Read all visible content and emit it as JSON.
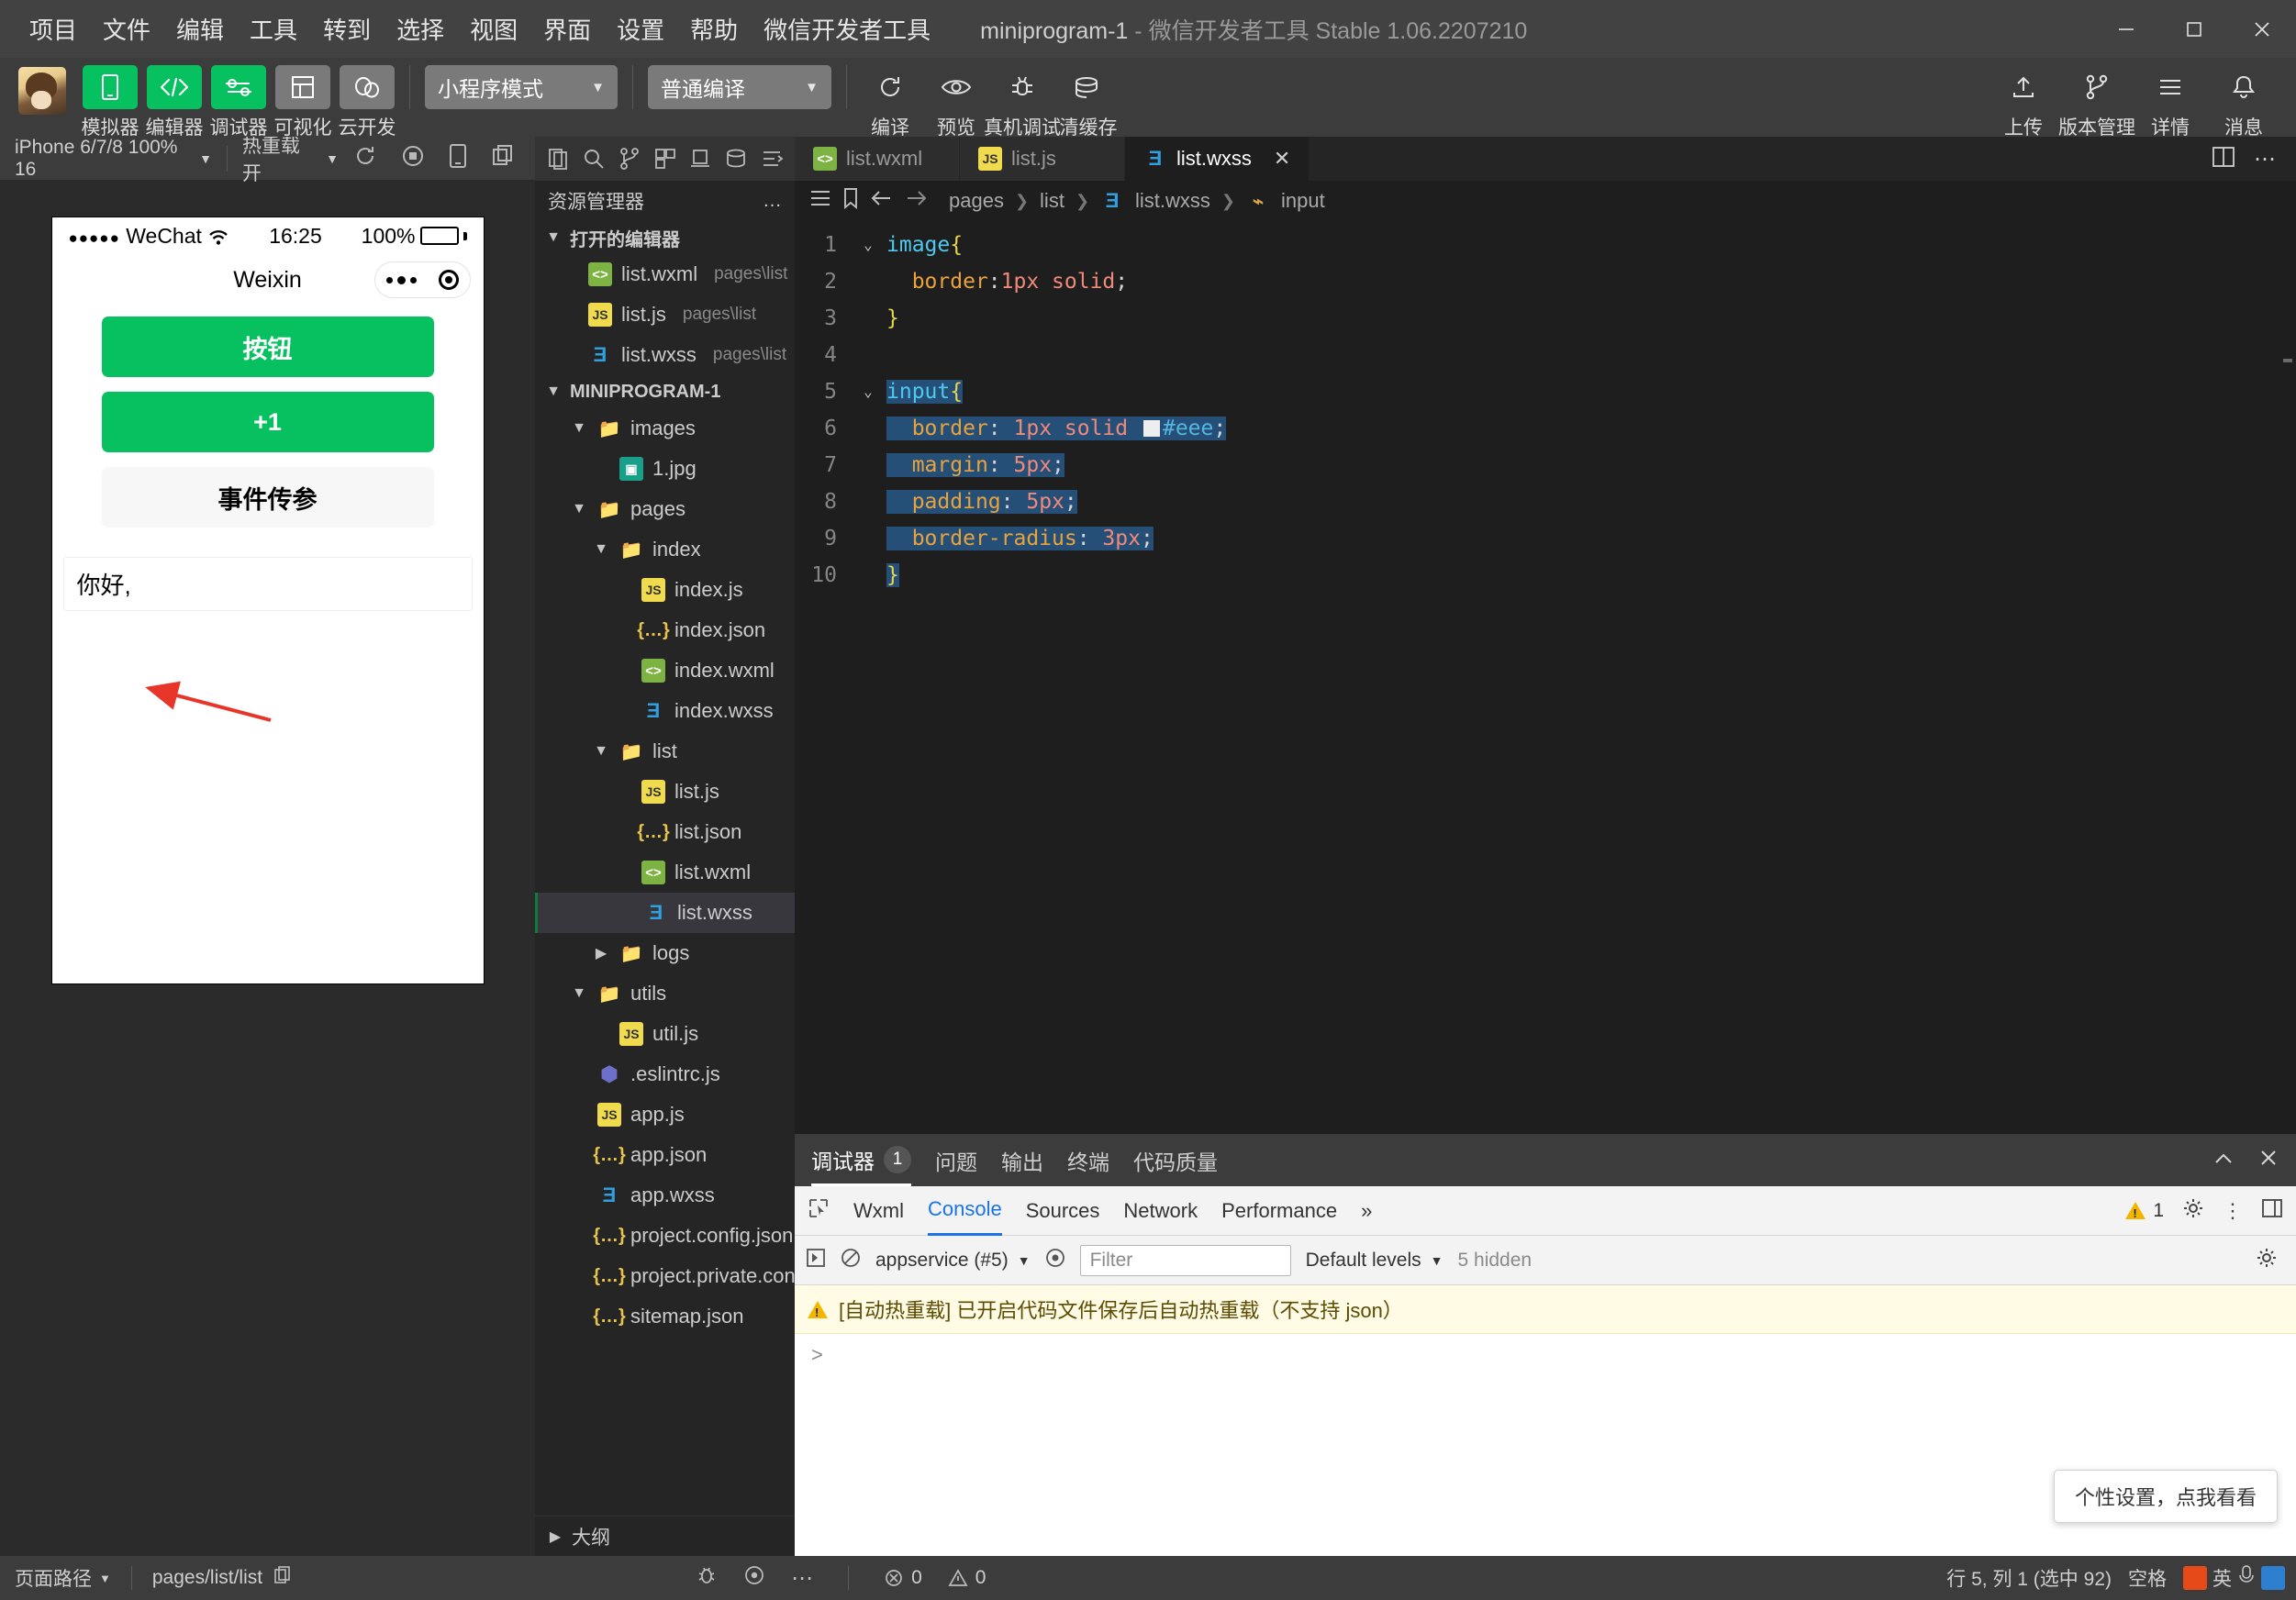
{
  "titlebar": {
    "menu": [
      "项目",
      "文件",
      "编辑",
      "工具",
      "转到",
      "选择",
      "视图",
      "界面",
      "设置",
      "帮助",
      "微信开发者工具"
    ],
    "project_name": "miniprogram-1",
    "dash": "-",
    "app_name": "微信开发者工具",
    "version": "Stable 1.06.2207210",
    "window_minimize": "minimize-icon",
    "window_maximize": "maximize-icon",
    "window_close": "close-icon"
  },
  "toolbar": {
    "avatar": "user-avatar",
    "buttons": [
      {
        "label": "模拟器",
        "icon": "phone-icon",
        "style": "green"
      },
      {
        "label": "编辑器",
        "icon": "code-icon",
        "style": "green"
      },
      {
        "label": "调试器",
        "icon": "sliders-icon",
        "style": "green"
      },
      {
        "label": "可视化",
        "icon": "layout-icon",
        "style": "grey"
      },
      {
        "label": "云开发",
        "icon": "cloud-icon",
        "style": "grey"
      }
    ],
    "mode_select": "小程序模式",
    "compile_select": "普通编译",
    "actions": [
      {
        "label": "编译",
        "icon": "refresh-icon"
      },
      {
        "label": "预览",
        "icon": "eye-icon"
      },
      {
        "label": "真机调试",
        "icon": "device-debug-icon"
      },
      {
        "label": "清缓存",
        "icon": "cache-icon"
      }
    ],
    "right_actions": [
      {
        "label": "上传",
        "icon": "upload-icon"
      },
      {
        "label": "版本管理",
        "icon": "branch-icon"
      },
      {
        "label": "详情",
        "icon": "menu-icon"
      },
      {
        "label": "消息",
        "icon": "bell-icon"
      }
    ]
  },
  "simulator": {
    "device": "iPhone 6/7/8 100% 16",
    "hotreload": "热重载 开",
    "tool_icons": [
      "rotate-icon",
      "record-stop-icon",
      "device-icon",
      "copy-icon"
    ],
    "phone": {
      "carrier": "WeChat",
      "time": "16:25",
      "battery": "100%",
      "nav_title": "Weixin",
      "buttons": [
        {
          "label": "按钮",
          "style": "primary"
        },
        {
          "label": "+1",
          "style": "primary"
        },
        {
          "label": "事件传参",
          "style": "default"
        }
      ],
      "input_value": "你好,"
    }
  },
  "explorer": {
    "title": "资源管理器",
    "more": "…",
    "activity_icons": [
      "files-icon",
      "search-icon",
      "source-control-icon",
      "extensions-icon",
      "debug-icon",
      "cloud-db-icon",
      "format-icon"
    ],
    "open_editors_label": "打开的编辑器",
    "open_editors": [
      {
        "name": "list.wxml",
        "path": "pages\\list",
        "type": "wxml"
      },
      {
        "name": "list.js",
        "path": "pages\\list",
        "type": "js"
      },
      {
        "name": "list.wxss",
        "path": "pages\\list",
        "type": "wxss"
      }
    ],
    "project_label": "MINIPROGRAM-1",
    "tree": [
      {
        "name": "images",
        "type": "folder-img",
        "depth": 1,
        "open": true
      },
      {
        "name": "1.jpg",
        "type": "img",
        "depth": 2
      },
      {
        "name": "pages",
        "type": "folder-code",
        "depth": 1,
        "open": true
      },
      {
        "name": "index",
        "type": "folder",
        "depth": 2,
        "open": true
      },
      {
        "name": "index.js",
        "type": "js",
        "depth": 3
      },
      {
        "name": "index.json",
        "type": "json",
        "depth": 3
      },
      {
        "name": "index.wxml",
        "type": "wxml",
        "depth": 3
      },
      {
        "name": "index.wxss",
        "type": "wxss",
        "depth": 3
      },
      {
        "name": "list",
        "type": "folder",
        "depth": 2,
        "open": true
      },
      {
        "name": "list.js",
        "type": "js",
        "depth": 3
      },
      {
        "name": "list.json",
        "type": "json",
        "depth": 3
      },
      {
        "name": "list.wxml",
        "type": "wxml",
        "depth": 3
      },
      {
        "name": "list.wxss",
        "type": "wxss",
        "depth": 3,
        "active": true
      },
      {
        "name": "logs",
        "type": "folder",
        "depth": 2,
        "open": false
      },
      {
        "name": "utils",
        "type": "folder-util",
        "depth": 1,
        "open": true
      },
      {
        "name": "util.js",
        "type": "js",
        "depth": 2
      },
      {
        "name": ".eslintrc.js",
        "type": "eslint",
        "depth": 1
      },
      {
        "name": "app.js",
        "type": "js",
        "depth": 1
      },
      {
        "name": "app.json",
        "type": "json",
        "depth": 1
      },
      {
        "name": "app.wxss",
        "type": "wxss",
        "depth": 1
      },
      {
        "name": "project.config.json",
        "type": "json",
        "depth": 1
      },
      {
        "name": "project.private.config.json",
        "type": "json",
        "depth": 1
      },
      {
        "name": "sitemap.json",
        "type": "json",
        "depth": 1
      }
    ],
    "outline_label": "大纲"
  },
  "editor": {
    "tabs": [
      {
        "label": "list.wxml",
        "type": "wxml",
        "active": false
      },
      {
        "label": "list.js",
        "type": "js",
        "active": false
      },
      {
        "label": "list.wxss",
        "type": "wxss",
        "active": true
      }
    ],
    "close_tab": "close-icon",
    "split_icon": "split-editor-icon",
    "more_icon": "more-actions-icon",
    "breadcrumb": [
      "pages",
      "list",
      "list.wxss",
      "input"
    ],
    "gutter_icons": [
      "outline-icon",
      "bookmark-icon",
      "back-arrow-icon",
      "forward-arrow-icon"
    ],
    "code_lines": [
      {
        "n": 1,
        "fold": "chevron-down",
        "tokens": [
          {
            "t": "image",
            "c": "sel"
          },
          {
            "t": "{",
            "c": "brace"
          }
        ]
      },
      {
        "n": 2,
        "fold": "",
        "tokens": [
          {
            "t": "  ",
            "c": "punc"
          },
          {
            "t": "border",
            "c": "prop"
          },
          {
            "t": ":",
            "c": "punc"
          },
          {
            "t": "1px solid",
            "c": "val"
          },
          {
            "t": ";",
            "c": "punc"
          }
        ]
      },
      {
        "n": 3,
        "fold": "",
        "tokens": [
          {
            "t": "}",
            "c": "brace"
          }
        ]
      },
      {
        "n": 4,
        "fold": "",
        "tokens": []
      },
      {
        "n": 5,
        "fold": "chevron-down",
        "tokens": [
          {
            "t": "input",
            "c": "sel"
          },
          {
            "t": "{",
            "c": "brace"
          }
        ]
      },
      {
        "n": 6,
        "fold": "",
        "tokens": [
          {
            "t": "  ",
            "c": "punc"
          },
          {
            "t": "border",
            "c": "prop"
          },
          {
            "t": ": ",
            "c": "punc"
          },
          {
            "t": "1px solid ",
            "c": "val"
          },
          {
            "t": "#eee",
            "c": "hex"
          },
          {
            "t": ";",
            "c": "punc"
          }
        ]
      },
      {
        "n": 7,
        "fold": "",
        "tokens": [
          {
            "t": "  ",
            "c": "punc"
          },
          {
            "t": "margin",
            "c": "prop"
          },
          {
            "t": ": ",
            "c": "punc"
          },
          {
            "t": "5px",
            "c": "val"
          },
          {
            "t": ";",
            "c": "punc"
          }
        ]
      },
      {
        "n": 8,
        "fold": "",
        "tokens": [
          {
            "t": "  ",
            "c": "punc"
          },
          {
            "t": "padding",
            "c": "prop"
          },
          {
            "t": ": ",
            "c": "punc"
          },
          {
            "t": "5px",
            "c": "val"
          },
          {
            "t": ";",
            "c": "punc"
          }
        ]
      },
      {
        "n": 9,
        "fold": "",
        "tokens": [
          {
            "t": "  ",
            "c": "punc"
          },
          {
            "t": "border-radius",
            "c": "prop"
          },
          {
            "t": ": ",
            "c": "punc"
          },
          {
            "t": "3px",
            "c": "val"
          },
          {
            "t": ";",
            "c": "punc"
          }
        ]
      },
      {
        "n": 10,
        "fold": "",
        "tokens": [
          {
            "t": "}",
            "c": "brace"
          }
        ]
      }
    ]
  },
  "console": {
    "panel_tabs": [
      {
        "label": "调试器",
        "badge": "1",
        "active": true
      },
      {
        "label": "问题",
        "badge": "",
        "active": false
      },
      {
        "label": "输出",
        "badge": "",
        "active": false
      },
      {
        "label": "终端",
        "badge": "",
        "active": false
      },
      {
        "label": "代码质量",
        "badge": "",
        "active": false
      }
    ],
    "collapse_icon": "chevron-up-icon",
    "close_icon": "close-icon",
    "devtools_tabs": [
      "Wxml",
      "Console",
      "Sources",
      "Network",
      "Performance"
    ],
    "devtools_active": "Console",
    "overflow": "»",
    "warning_count": "1",
    "settings_icon": "gear-icon",
    "kebab_icon": "more-vertical-icon",
    "dock_icon": "dock-icon",
    "inspect_icon": "inspect-icon",
    "execute_icon": "execute-icon",
    "clear_icon": "clear-icon",
    "eye_icon": "eye-icon",
    "context": "appservice (#5)",
    "filter_placeholder": "Filter",
    "levels": "Default levels",
    "hidden_count": "5 hidden",
    "message": "[自动热重载] 已开启代码文件保存后自动热重载（不支持 json）",
    "prompt": ">",
    "tip_popup": "个性设置，点我看看"
  },
  "statusbar": {
    "page_path_label": "页面路径",
    "page_path": "pages/list/list",
    "copy_icon": "copy-icon",
    "bug_icon": "bug-icon",
    "eye_icon": "eye-icon",
    "more_icon": "more-icon",
    "errors": "0",
    "warnings": "0",
    "cursor": "行 5, 列 1 (选中 92)",
    "encoding": "空格",
    "ime_lang": "英",
    "ime_icons": [
      "wechat-icon",
      "mic-icon",
      "keyboard-icon"
    ]
  }
}
